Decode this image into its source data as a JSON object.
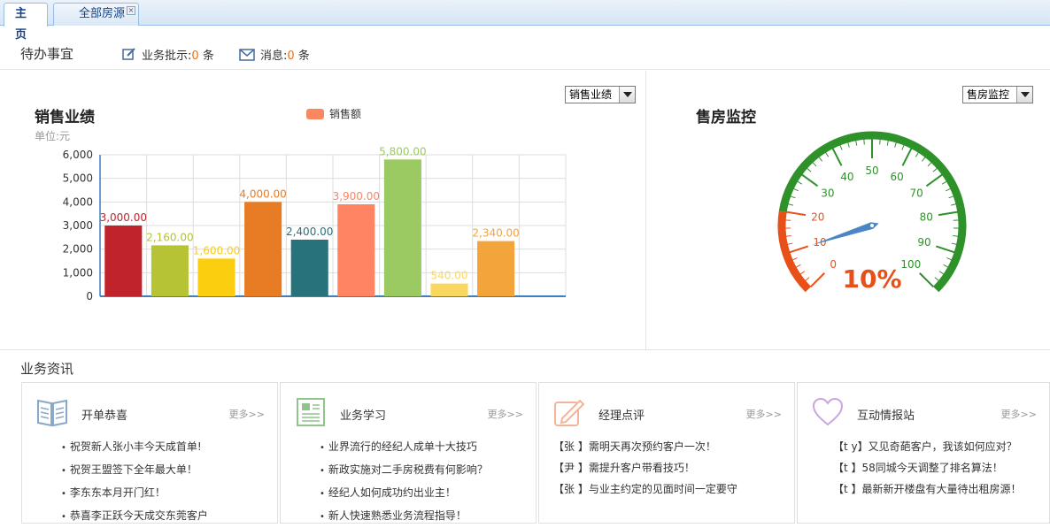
{
  "tabs": [
    {
      "label": "主页",
      "active": true
    },
    {
      "label": "全部房源",
      "active": false,
      "closable": true
    }
  ],
  "todo": {
    "title": "待办事宜",
    "approvals_label": "业务批示:",
    "approvals_count": "0",
    "approvals_unit": "条",
    "messages_label": "消息:",
    "messages_count": "0",
    "messages_unit": "条"
  },
  "sales": {
    "title": "销售业绩",
    "unit": "单位:元",
    "select_value": "销售业绩",
    "legend": "销售额"
  },
  "chart_data": {
    "type": "bar",
    "categories": [
      "",
      "",
      "",
      "",
      "",
      "",
      "",
      "",
      ""
    ],
    "series": [
      {
        "name": "销售额",
        "values": [
          3000,
          2160,
          1600,
          4000,
          2400,
          3900,
          5800,
          540,
          2340
        ]
      }
    ],
    "value_labels": [
      "3,000.00",
      "2,160.00",
      "1,600.00",
      "4,000.00",
      "2,400.00",
      "3,900.00",
      "5,800.00",
      "540.00",
      "2,340.00"
    ],
    "colors": [
      "#c1232b",
      "#b5c334",
      "#fcce10",
      "#e87c25",
      "#27727b",
      "#fe8463",
      "#9bca63",
      "#fad860",
      "#f3a43b"
    ],
    "yticks": [
      "0",
      "1,000",
      "2,000",
      "3,000",
      "4,000",
      "5,000",
      "6,000"
    ],
    "ylim": [
      0,
      6000
    ],
    "grid": true
  },
  "monitor": {
    "title": "售房监控",
    "select_value": "售房监控",
    "gauge": {
      "value": 10,
      "value_text": "10%",
      "min": 0,
      "max": 100,
      "ticks": [
        "0",
        "10",
        "20",
        "30",
        "40",
        "50",
        "60",
        "70",
        "80",
        "90",
        "100"
      ],
      "low_color": "#e8501a",
      "high_color": "#2e9129"
    }
  },
  "news": {
    "title": "业务资讯",
    "more_label": "更多>>",
    "cards": [
      {
        "title": "开单恭喜",
        "icon": "book-icon",
        "bullet": true,
        "items": [
          "祝贺新人张小丰今天成首单!",
          "祝贺王盟签下全年最大单！",
          "李东东本月开门红！",
          "恭喜李正跃今天成交东莞客户"
        ]
      },
      {
        "title": "业务学习",
        "icon": "document-icon",
        "bullet": true,
        "items": [
          "业界流行的经纪人成单十大技巧",
          "新政实施对二手房税费有何影响？",
          "经纪人如何成功约出业主！",
          "新人快速熟悉业务流程指导！"
        ]
      },
      {
        "title": "经理点评",
        "icon": "pencil-icon",
        "bullet": false,
        "items": [
          "【张  】需明天再次预约客户一次！",
          "【尹  】需提升客户带看技巧！",
          "【张  】与业主约定的见面时间一定要守"
        ]
      },
      {
        "title": "互动情报站",
        "icon": "heart-icon",
        "bullet": false,
        "items": [
          "【t   y】又见奇葩客户，我该如何应对？",
          "【t   】58同城今天调整了排名算法！",
          "【t   】最新新开楼盘有大量待出租房源！"
        ]
      }
    ]
  }
}
